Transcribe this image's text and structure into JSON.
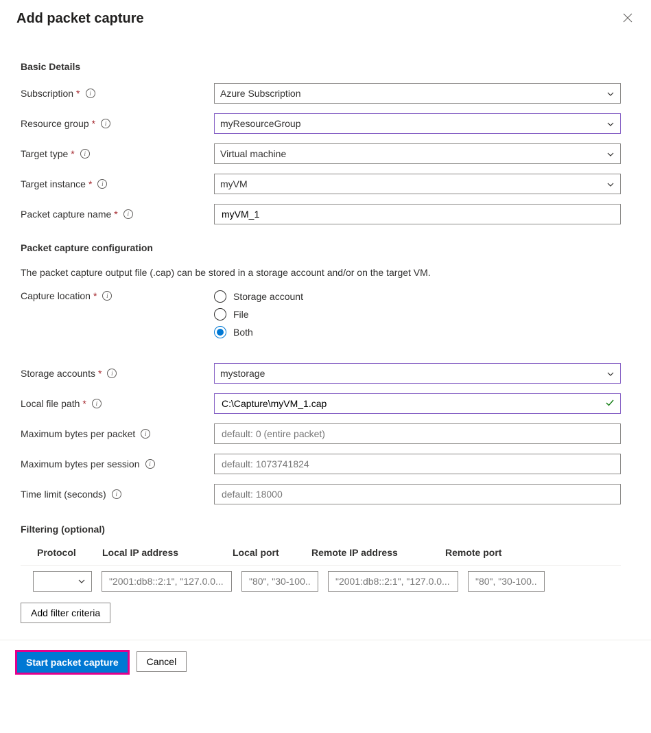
{
  "title": "Add packet capture",
  "sections": {
    "basic": "Basic Details",
    "config": "Packet capture configuration",
    "filtering": "Filtering (optional)"
  },
  "fields": {
    "subscription": {
      "label": "Subscription",
      "required": true,
      "info": true,
      "value": "Azure Subscription"
    },
    "resource_group": {
      "label": "Resource group",
      "required": true,
      "info": true,
      "value": "myResourceGroup"
    },
    "target_type": {
      "label": "Target type",
      "required": true,
      "info": true,
      "value": "Virtual machine"
    },
    "target_instance": {
      "label": "Target instance",
      "required": true,
      "info": true,
      "value": "myVM"
    },
    "packet_capture_name": {
      "label": "Packet capture name",
      "required": true,
      "info": true,
      "value": "myVM_1"
    },
    "capture_location": {
      "label": "Capture location",
      "required": true,
      "info": true,
      "options": [
        "Storage account",
        "File",
        "Both"
      ],
      "selected": "Both"
    },
    "storage_accounts": {
      "label": "Storage accounts",
      "required": true,
      "info": true,
      "value": "mystorage"
    },
    "local_file_path": {
      "label": "Local file path",
      "required": true,
      "info": true,
      "value": "C:\\Capture\\myVM_1.cap",
      "valid": true
    },
    "max_bytes_packet": {
      "label": "Maximum bytes per packet",
      "required": false,
      "info": true,
      "placeholder": "default: 0 (entire packet)"
    },
    "max_bytes_session": {
      "label": "Maximum bytes per session",
      "required": false,
      "info": true,
      "placeholder": "default: 1073741824"
    },
    "time_limit": {
      "label": "Time limit (seconds)",
      "required": false,
      "info": true,
      "placeholder": "default: 18000"
    }
  },
  "config_desc": "The packet capture output file (.cap) can be stored in a storage account and/or on the target VM.",
  "filter": {
    "headers": {
      "protocol": "Protocol",
      "local_ip": "Local IP address",
      "local_port": "Local port",
      "remote_ip": "Remote IP address",
      "remote_port": "Remote port"
    },
    "placeholders": {
      "local_ip": "\"2001:db8::2:1\", \"127.0.0....",
      "local_port": "\"80\", \"30-100...",
      "remote_ip": "\"2001:db8::2:1\", \"127.0.0....",
      "remote_port": "\"80\", \"30-100..."
    },
    "add_button": "Add filter criteria"
  },
  "footer": {
    "primary": "Start packet capture",
    "cancel": "Cancel"
  }
}
